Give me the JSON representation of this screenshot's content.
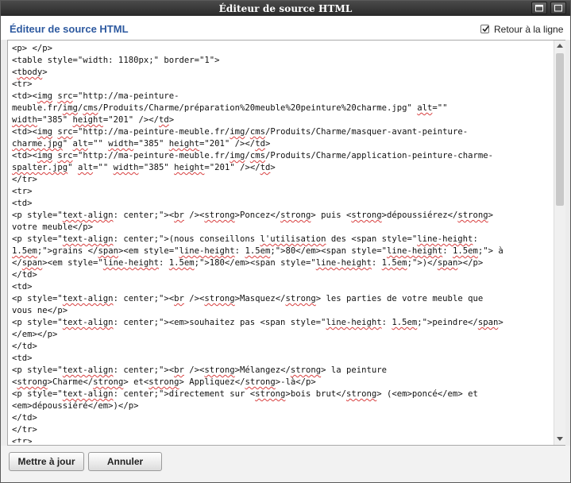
{
  "window": {
    "title": "Éditeur de source HTML"
  },
  "header": {
    "heading": "Éditeur de source HTML",
    "wrap_label": "Retour à la ligne",
    "wrap_checked": true
  },
  "source_lines": [
    [
      {
        "t": "<p> </p>"
      }
    ],
    [
      {
        "t": "<table style=\"width: 1180px;\" border=\"1\">"
      }
    ],
    [
      {
        "t": "<"
      },
      {
        "t": "tbody",
        "s": 1
      },
      {
        "t": ">"
      }
    ],
    [
      {
        "t": "<tr>"
      }
    ],
    [
      {
        "t": "<td><"
      },
      {
        "t": "img",
        "s": 1
      },
      {
        "t": " "
      },
      {
        "t": "src",
        "s": 1
      },
      {
        "t": "=\"http://ma-peinture-"
      }
    ],
    [
      {
        "t": "meuble.fr/"
      },
      {
        "t": "img",
        "s": 1
      },
      {
        "t": "/"
      },
      {
        "t": "cms",
        "s": 1
      },
      {
        "t": "/Produits/Charme/préparation%20meuble%20peinture%20charme.jpg\" "
      },
      {
        "t": "alt",
        "s": 1
      },
      {
        "t": "=\"\""
      }
    ],
    [
      {
        "t": "width",
        "s": 1
      },
      {
        "t": "=\"385\" "
      },
      {
        "t": "height",
        "s": 1
      },
      {
        "t": "=\"201\" /></"
      },
      {
        "t": "td",
        "s": 1
      },
      {
        "t": ">"
      }
    ],
    [
      {
        "t": "<td><"
      },
      {
        "t": "img",
        "s": 1
      },
      {
        "t": " "
      },
      {
        "t": "src",
        "s": 1
      },
      {
        "t": "=\"http://ma-peinture-meuble.fr/"
      },
      {
        "t": "img",
        "s": 1
      },
      {
        "t": "/"
      },
      {
        "t": "cms",
        "s": 1
      },
      {
        "t": "/Produits/Charme/masquer-avant-peinture-"
      }
    ],
    [
      {
        "t": "charme.jpg",
        "s": 1
      },
      {
        "t": "\" "
      },
      {
        "t": "alt",
        "s": 1
      },
      {
        "t": "=\"\" "
      },
      {
        "t": "width",
        "s": 1
      },
      {
        "t": "=\"385\" "
      },
      {
        "t": "height",
        "s": 1
      },
      {
        "t": "=\"201\" /></"
      },
      {
        "t": "td",
        "s": 1
      },
      {
        "t": ">"
      }
    ],
    [
      {
        "t": "<td><"
      },
      {
        "t": "img",
        "s": 1
      },
      {
        "t": " "
      },
      {
        "t": "src",
        "s": 1
      },
      {
        "t": "=\"http://ma-peinture-meuble.fr/"
      },
      {
        "t": "img",
        "s": 1
      },
      {
        "t": "/"
      },
      {
        "t": "cms",
        "s": 1
      },
      {
        "t": "/Produits/Charme/application-peinture-charme-"
      }
    ],
    [
      {
        "t": "spalter.jpg",
        "s": 1
      },
      {
        "t": "\" "
      },
      {
        "t": "alt",
        "s": 1
      },
      {
        "t": "=\"\" "
      },
      {
        "t": "width",
        "s": 1
      },
      {
        "t": "=\"385\" "
      },
      {
        "t": "height",
        "s": 1
      },
      {
        "t": "=\"201\" /></"
      },
      {
        "t": "td",
        "s": 1
      },
      {
        "t": ">"
      }
    ],
    [
      {
        "t": "</tr>"
      }
    ],
    [
      {
        "t": "<tr>"
      }
    ],
    [
      {
        "t": "<td>"
      }
    ],
    [
      {
        "t": "<p style=\""
      },
      {
        "t": "text-align",
        "s": 1
      },
      {
        "t": ": center;\"><"
      },
      {
        "t": "br",
        "s": 1
      },
      {
        "t": " /><"
      },
      {
        "t": "strong",
        "s": 1
      },
      {
        "t": ">Poncez</"
      },
      {
        "t": "strong",
        "s": 1
      },
      {
        "t": "> puis <"
      },
      {
        "t": "strong",
        "s": 1
      },
      {
        "t": ">dépoussiérez</"
      },
      {
        "t": "strong",
        "s": 1
      },
      {
        "t": ">"
      }
    ],
    [
      {
        "t": "votre meuble</p>"
      }
    ],
    [
      {
        "t": "<p style=\""
      },
      {
        "t": "text-align",
        "s": 1
      },
      {
        "t": ": center;\">(nous conseillons "
      },
      {
        "t": "l'utilisation",
        "s": 1
      },
      {
        "t": " des <span style=\""
      },
      {
        "t": "line-height",
        "s": 1
      },
      {
        "t": ":"
      }
    ],
    [
      {
        "t": "1.5em",
        "s": 1
      },
      {
        "t": ";\">grains </"
      },
      {
        "t": "span",
        "s": 1
      },
      {
        "t": "><em style=\""
      },
      {
        "t": "line-height",
        "s": 1
      },
      {
        "t": ": "
      },
      {
        "t": "1.5em",
        "s": 1
      },
      {
        "t": ";\">80</em><span style=\""
      },
      {
        "t": "line-height",
        "s": 1
      },
      {
        "t": ": "
      },
      {
        "t": "1.5em",
        "s": 1
      },
      {
        "t": ";\"> à"
      }
    ],
    [
      {
        "t": "</"
      },
      {
        "t": "span",
        "s": 1
      },
      {
        "t": "><em style=\""
      },
      {
        "t": "line-height",
        "s": 1
      },
      {
        "t": ": "
      },
      {
        "t": "1.5em",
        "s": 1
      },
      {
        "t": ";\">180</em><span style=\""
      },
      {
        "t": "line-height",
        "s": 1
      },
      {
        "t": ": "
      },
      {
        "t": "1.5em",
        "s": 1
      },
      {
        "t": ";\">)</"
      },
      {
        "t": "span",
        "s": 1
      },
      {
        "t": "></p>"
      }
    ],
    [
      {
        "t": "</td>"
      }
    ],
    [
      {
        "t": "<td>"
      }
    ],
    [
      {
        "t": "<p style=\""
      },
      {
        "t": "text-align",
        "s": 1
      },
      {
        "t": ": center;\"><"
      },
      {
        "t": "br",
        "s": 1
      },
      {
        "t": " /><"
      },
      {
        "t": "strong",
        "s": 1
      },
      {
        "t": ">Masquez</"
      },
      {
        "t": "strong",
        "s": 1
      },
      {
        "t": "> les parties de votre meuble que"
      }
    ],
    [
      {
        "t": "vous ne</p>"
      }
    ],
    [
      {
        "t": "<p style=\""
      },
      {
        "t": "text-align",
        "s": 1
      },
      {
        "t": ": center;\"><em>souhaitez pas <span style=\""
      },
      {
        "t": "line-height",
        "s": 1
      },
      {
        "t": ": "
      },
      {
        "t": "1.5em",
        "s": 1
      },
      {
        "t": ";\">peindre</"
      },
      {
        "t": "span",
        "s": 1
      },
      {
        "t": ">"
      }
    ],
    [
      {
        "t": "</em></p>"
      }
    ],
    [
      {
        "t": "</td>"
      }
    ],
    [
      {
        "t": "<td>"
      }
    ],
    [
      {
        "t": "<p style=\""
      },
      {
        "t": "text-align",
        "s": 1
      },
      {
        "t": ": center;\"><"
      },
      {
        "t": "br",
        "s": 1
      },
      {
        "t": " /><"
      },
      {
        "t": "strong",
        "s": 1
      },
      {
        "t": ">Mélangez</"
      },
      {
        "t": "strong",
        "s": 1
      },
      {
        "t": "> la peinture"
      }
    ],
    [
      {
        "t": "<"
      },
      {
        "t": "strong",
        "s": 1
      },
      {
        "t": ">Charme</"
      },
      {
        "t": "strong",
        "s": 1
      },
      {
        "t": "> et<"
      },
      {
        "t": "strong",
        "s": 1
      },
      {
        "t": "> Appliquez</"
      },
      {
        "t": "strong",
        "s": 1
      },
      {
        "t": ">-là</p>"
      }
    ],
    [
      {
        "t": "<p style=\""
      },
      {
        "t": "text-align",
        "s": 1
      },
      {
        "t": ": center;\">directement sur <"
      },
      {
        "t": "strong",
        "s": 1
      },
      {
        "t": ">bois brut</"
      },
      {
        "t": "strong",
        "s": 1
      },
      {
        "t": "> (<em>poncé</em> et"
      }
    ],
    [
      {
        "t": "<em>dépoussiéré</em>)</p>"
      }
    ],
    [
      {
        "t": "</td>"
      }
    ],
    [
      {
        "t": "</tr>"
      }
    ],
    [
      {
        "t": "<tr>"
      }
    ]
  ],
  "footer": {
    "update_label": "Mettre à jour",
    "cancel_label": "Annuler"
  },
  "colors": {
    "heading": "#2e5aa0",
    "titlebar": "#333333",
    "spellcheck": "#d84040"
  }
}
